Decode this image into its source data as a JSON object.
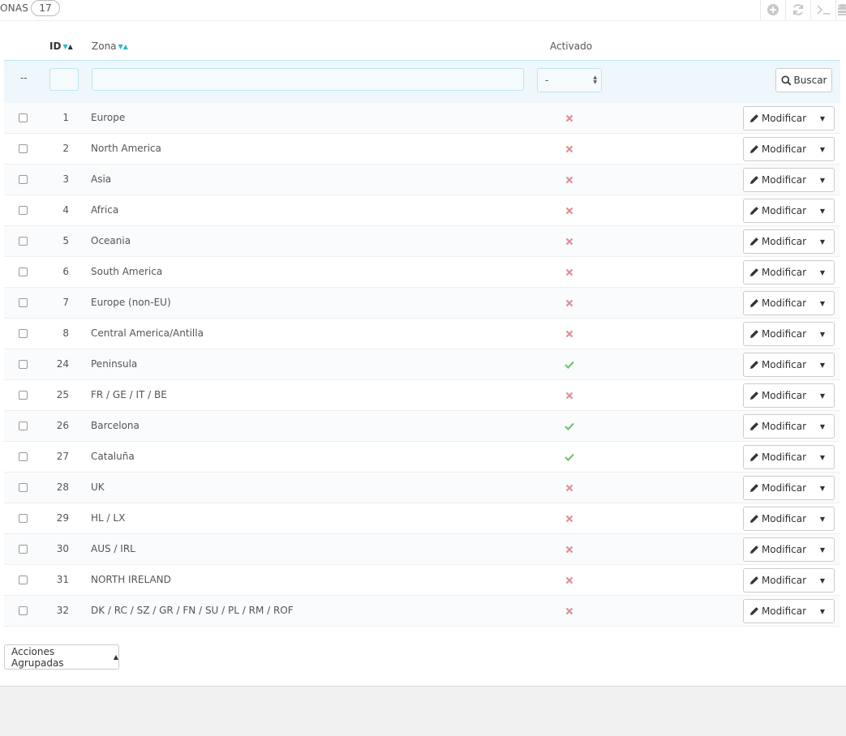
{
  "header": {
    "title": "ONAS",
    "count": "17"
  },
  "toolbar": [
    {
      "name": "add-new-icon",
      "glyph": "plus-circle"
    },
    {
      "name": "refresh-icon",
      "glyph": "refresh"
    },
    {
      "name": "sql-query-icon",
      "glyph": "terminal"
    },
    {
      "name": "database-icon",
      "glyph": "database"
    }
  ],
  "columns": {
    "id": "ID",
    "zone": "Zona",
    "active": "Activado"
  },
  "filters": {
    "bulk_placeholder": "--",
    "active_select": "-",
    "search_label": "Buscar"
  },
  "rows": [
    {
      "id": "1",
      "zone": "Europe",
      "active": false
    },
    {
      "id": "2",
      "zone": "North America",
      "active": false
    },
    {
      "id": "3",
      "zone": "Asia",
      "active": false
    },
    {
      "id": "4",
      "zone": "Africa",
      "active": false
    },
    {
      "id": "5",
      "zone": "Oceania",
      "active": false
    },
    {
      "id": "6",
      "zone": "South America",
      "active": false
    },
    {
      "id": "7",
      "zone": "Europe (non-EU)",
      "active": false
    },
    {
      "id": "8",
      "zone": "Central America/Antilla",
      "active": false
    },
    {
      "id": "24",
      "zone": "Peninsula",
      "active": true
    },
    {
      "id": "25",
      "zone": "FR / GE / IT / BE",
      "active": false
    },
    {
      "id": "26",
      "zone": "Barcelona",
      "active": true
    },
    {
      "id": "27",
      "zone": "Cataluña",
      "active": true
    },
    {
      "id": "28",
      "zone": "UK",
      "active": false
    },
    {
      "id": "29",
      "zone": "HL / LX",
      "active": false
    },
    {
      "id": "30",
      "zone": "AUS / IRL",
      "active": false
    },
    {
      "id": "31",
      "zone": "NORTH IRELAND",
      "active": false
    },
    {
      "id": "32",
      "zone": "DK / RC / SZ / GR / FN / SU / PL / RM / ROF",
      "active": false
    }
  ],
  "row_action_label": "Modificar",
  "bulk_actions_label": "Acciones Agrupadas",
  "colors": {
    "enabled": "#72c279",
    "disabled": "#e08f95",
    "accent": "#25b9d7"
  }
}
